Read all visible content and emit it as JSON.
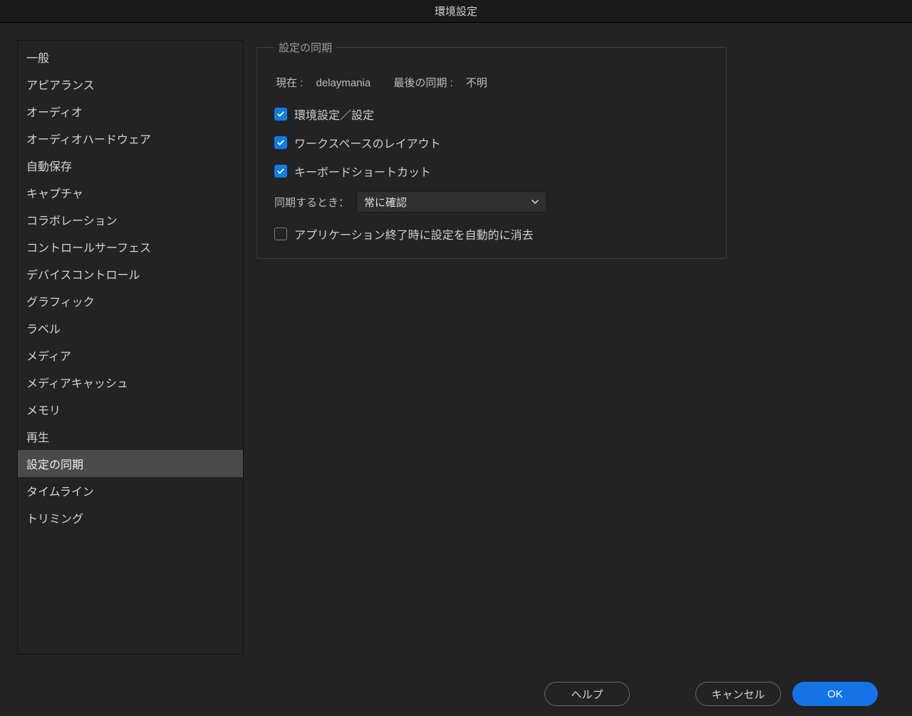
{
  "title": "環境設定",
  "sidebar": {
    "items": [
      {
        "label": "一般",
        "selected": false
      },
      {
        "label": "アピアランス",
        "selected": false
      },
      {
        "label": "オーディオ",
        "selected": false
      },
      {
        "label": "オーディオハードウェア",
        "selected": false
      },
      {
        "label": "自動保存",
        "selected": false
      },
      {
        "label": "キャプチャ",
        "selected": false
      },
      {
        "label": "コラボレーション",
        "selected": false
      },
      {
        "label": "コントロールサーフェス",
        "selected": false
      },
      {
        "label": "デバイスコントロール",
        "selected": false
      },
      {
        "label": "グラフィック",
        "selected": false
      },
      {
        "label": "ラベル",
        "selected": false
      },
      {
        "label": "メディア",
        "selected": false
      },
      {
        "label": "メディアキャッシュ",
        "selected": false
      },
      {
        "label": "メモリ",
        "selected": false
      },
      {
        "label": "再生",
        "selected": false
      },
      {
        "label": "設定の同期",
        "selected": true
      },
      {
        "label": "タイムライン",
        "selected": false
      },
      {
        "label": "トリミング",
        "selected": false
      }
    ]
  },
  "panel": {
    "legend": "設定の同期",
    "current_label": "現在 : ",
    "current_user": "delaymania",
    "last_sync_label": "最後の同期 : ",
    "last_sync_value": "不明",
    "checkbox_prefs": {
      "label": "環境設定／設定",
      "checked": true
    },
    "checkbox_workspace": {
      "label": "ワークスペースのレイアウト",
      "checked": true
    },
    "checkbox_shortcuts": {
      "label": "キーボードショートカット",
      "checked": true
    },
    "sync_when_label": "同期するとき：",
    "sync_when_value": "常に確認",
    "checkbox_clear_on_quit": {
      "label": "アプリケーション終了時に設定を自動的に消去",
      "checked": false
    }
  },
  "footer": {
    "help": "ヘルプ",
    "cancel": "キャンセル",
    "ok": "OK"
  }
}
